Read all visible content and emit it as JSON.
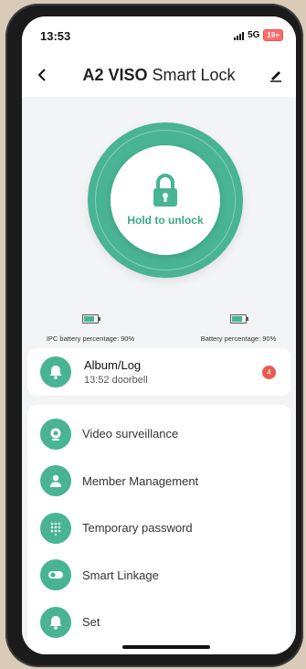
{
  "status": {
    "time": "13:53",
    "network": "5G",
    "battery": "19+"
  },
  "header": {
    "title_bold": "A2 VISO",
    "title_rest": " Smart Lock"
  },
  "lock": {
    "button_label": "Hold to unlock"
  },
  "batteries": {
    "ipc_label": "IPC battery percentage: 90%",
    "ipc_level": 0.9,
    "lock_label": "Battery percentage: 90%",
    "lock_level": 0.9
  },
  "album": {
    "title": "Album/Log",
    "subtitle": "13:52 doorbell",
    "badge": "4"
  },
  "menu": {
    "items": [
      {
        "label": "Video surveillance",
        "icon": "camera-icon"
      },
      {
        "label": "Member Management",
        "icon": "person-icon"
      },
      {
        "label": "Temporary password",
        "icon": "keypad-icon"
      },
      {
        "label": "Smart Linkage",
        "icon": "toggle-icon"
      },
      {
        "label": "Set",
        "icon": "bell-icon"
      }
    ]
  },
  "colors": {
    "accent": "#48b494",
    "badge": "#e85a4f"
  }
}
